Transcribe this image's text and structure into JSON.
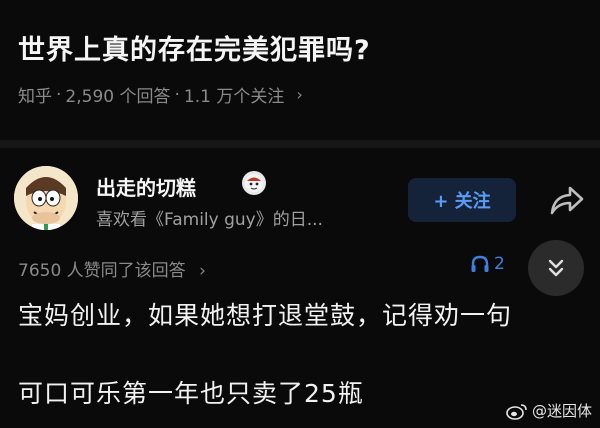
{
  "question": {
    "title": "世界上真的存在完美犯罪吗?",
    "source": "知乎",
    "answer_count": "2,590 个回答",
    "follower_count": "1.1 万个关注",
    "separator": "·",
    "chevron": "›"
  },
  "answer": {
    "author_name": "出走的切糕",
    "author_bio": "喜欢看《Family guy》的日...",
    "follow_label": "+ 关注",
    "upvote_text": "7650 人赞同了该回答",
    "listen_text": "2",
    "chevron": "›",
    "content_line1": "宝妈创业，如果她想打退堂鼓，记得劝一句",
    "content_line2": "可口可乐第一年也只卖了25瓶"
  },
  "watermark": {
    "text": "@迷因体"
  },
  "icons": {
    "avatar": "cartoon-avatar",
    "badge": "author-badge-icon",
    "share": "share-icon",
    "headphones": "headphones-icon",
    "collapse": "double-chevron-down-icon",
    "weibo": "weibo-logo-icon"
  },
  "colors": {
    "background": "#0a0a0a",
    "accent_blue": "#5a9cf8",
    "muted_text": "#8a8a8a"
  }
}
